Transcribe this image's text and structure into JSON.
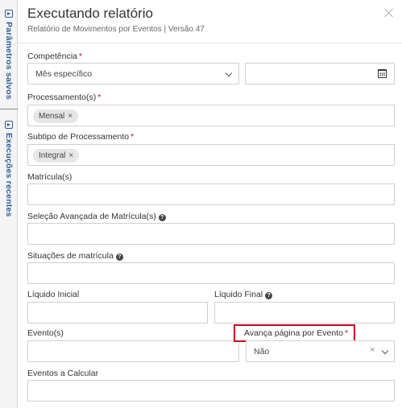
{
  "rail": {
    "saved_params": "Parâmetros salvos",
    "recent_runs": "Execuções recentes"
  },
  "header": {
    "title": "Executando relatório",
    "subtitle": "Relatório de Movimentos por Eventos | Versão 47"
  },
  "form": {
    "competencia": {
      "label": "Competência",
      "select_value": "Mês específico",
      "date_value": ""
    },
    "processamentos": {
      "label": "Processamento(s)",
      "chips": [
        "Mensal"
      ]
    },
    "subtipo": {
      "label": "Subtipo de Processamento",
      "chips": [
        "Integral"
      ]
    },
    "matriculas": {
      "label": "Matrícula(s)",
      "value": ""
    },
    "selecao_avancada": {
      "label": "Seleção Avançada de Matrícula(s)",
      "value": ""
    },
    "situacoes": {
      "label": "Situações de matrícula",
      "value": ""
    },
    "liquido_inicial": {
      "label": "Líquido Inicial",
      "value": ""
    },
    "liquido_final": {
      "label": "Líquido Final",
      "value": ""
    },
    "eventos": {
      "label": "Evento(s)",
      "value": ""
    },
    "avanca_pagina": {
      "label": "Avança página por Evento",
      "value": "Não"
    },
    "eventos_calcular": {
      "label": "Eventos a Calcular",
      "value": ""
    },
    "required_mark": "*",
    "help_mark": "?",
    "chip_remove": "×"
  },
  "colors": {
    "accent": "#2f5c98",
    "required": "#d0021b",
    "highlight": "#d0021b"
  }
}
